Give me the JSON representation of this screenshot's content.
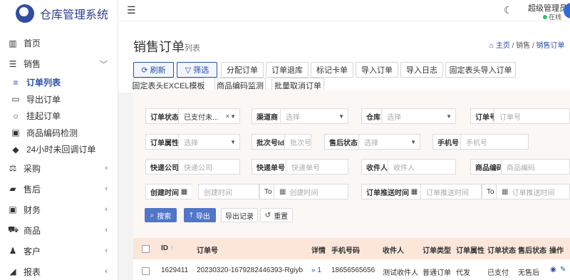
{
  "brand": {
    "title": "仓库管理系统"
  },
  "sidebar": {
    "items": [
      {
        "label": "首页",
        "icon": "dashboard-icon",
        "glyph": "▥"
      },
      {
        "label": "销售",
        "icon": "list-icon",
        "glyph": "☰",
        "arrow": "﹀"
      },
      {
        "label": "订单列表",
        "icon": "list-icon",
        "glyph": "≡",
        "active": true
      },
      {
        "label": "导出订单",
        "icon": "document-icon",
        "glyph": "▭"
      },
      {
        "label": "挂起订单",
        "icon": "circle-icon",
        "glyph": "○"
      },
      {
        "label": "商品编码检测",
        "icon": "calendar-check-icon",
        "glyph": "▣"
      },
      {
        "label": "24小时未回调订单",
        "icon": "android-icon",
        "glyph": "◆"
      },
      {
        "label": "采购",
        "icon": "scale-icon",
        "glyph": "⚖",
        "arrow": "‹"
      },
      {
        "label": "售后",
        "icon": "truck-icon",
        "glyph": "▰",
        "arrow": "‹"
      },
      {
        "label": "财务",
        "icon": "money-icon",
        "glyph": "▣",
        "arrow": "‹"
      },
      {
        "label": "商品",
        "icon": "cart-icon",
        "glyph": "⛟",
        "arrow": "‹"
      },
      {
        "label": "客户",
        "icon": "user-icon",
        "glyph": "♟",
        "arrow": "‹"
      },
      {
        "label": "报表",
        "icon": "rss-icon",
        "glyph": "◢",
        "arrow": "‹"
      }
    ]
  },
  "topbar": {
    "menu_glyph": "☰",
    "theme_glyph": "☾",
    "user_name": "超级管理员",
    "user_status": "在线"
  },
  "page": {
    "title": "销售订单",
    "subtitle": "列表"
  },
  "breadcrumb": {
    "home": "主页",
    "sep": "/",
    "section": "销售",
    "current": "销售订单"
  },
  "toolbar": {
    "refresh": "刷新",
    "filter": "筛选",
    "assign": "分配订单",
    "return": "订单退库",
    "mark": "标记卡单",
    "import": "导入订单",
    "import_log": "导入日志",
    "fixed_import": "固定表头导入订单",
    "fixed_template": "固定表头EXCEL模板",
    "code_monitor": "商品编码监测",
    "batch_cancel": "批量取消订单"
  },
  "filters": {
    "order_status": {
      "label": "订单状态",
      "value": "已支付未..."
    },
    "channel": {
      "label": "渠道商",
      "placeholder": "选择"
    },
    "warehouse": {
      "label": "仓库",
      "placeholder": "选择"
    },
    "order_no": {
      "label": "订单号",
      "placeholder": "订单号"
    },
    "order_attr": {
      "label": "订单属性",
      "placeholder": "选择"
    },
    "batch_id": {
      "label": "批次号Id",
      "placeholder": "批次号"
    },
    "after_sale": {
      "label": "售后状态",
      "placeholder": "选择"
    },
    "phone": {
      "label": "手机号",
      "placeholder": "手机号"
    },
    "courier": {
      "label": "快递公司",
      "placeholder": "快递公司"
    },
    "tracking": {
      "label": "快递单号",
      "placeholder": "快递单号"
    },
    "receiver": {
      "label": "收件人",
      "placeholder": "收件人"
    },
    "sku": {
      "label": "商品编码",
      "placeholder": "商品编码"
    },
    "create_time": {
      "label": "创建时间",
      "from_placeholder": "创建时间",
      "to": "To",
      "to_placeholder": "创建时间"
    },
    "push_time": {
      "label": "订单推送时间",
      "from_placeholder": "订单推送时间",
      "to": "To",
      "to_placeholder": "订单推送时间"
    }
  },
  "actions": {
    "search": "搜索",
    "export": "导出",
    "export_log": "导出记录",
    "reset": "重置"
  },
  "table": {
    "columns": [
      "ID",
      "订单号",
      "详情",
      "手机号码",
      "收件人",
      "订单类型",
      "订单属性",
      "订单状态",
      "售后状态",
      "操作"
    ],
    "sort_glyph": "↑",
    "rows": [
      {
        "id": "1629411",
        "order_no": "20230320-1679282446393-Rgiyb",
        "detail": "» 1",
        "phone": "18656565656",
        "receiver": "测试收件人",
        "type": "普通订单",
        "attr": "代发",
        "status": "已支付",
        "after_sale": "无售后"
      }
    ]
  },
  "colors": {
    "accent": "#2c4fa8",
    "button_blue": "#5075c9",
    "table_header": "#fbe6d9",
    "filter_bg": "#fbf7f4"
  }
}
